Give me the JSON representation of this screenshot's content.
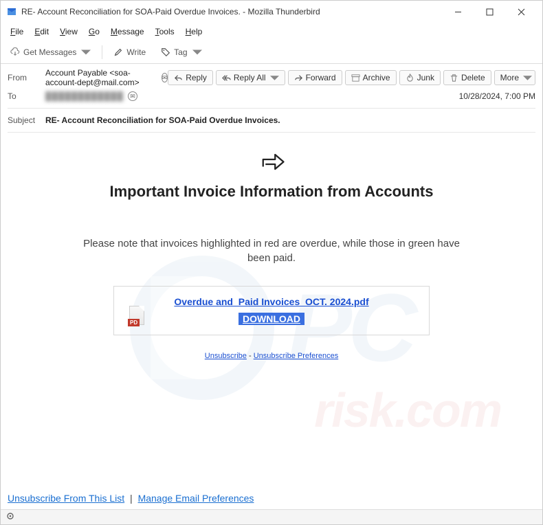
{
  "window": {
    "title": "RE- Account Reconciliation for SOA-Paid Overdue Invoices. - Mozilla Thunderbird"
  },
  "menu": {
    "file": "File",
    "edit": "Edit",
    "view": "View",
    "go": "Go",
    "message": "Message",
    "tools": "Tools",
    "help": "Help"
  },
  "toolbar": {
    "get_messages": "Get Messages",
    "write": "Write",
    "tag": "Tag"
  },
  "headers": {
    "from_label": "From",
    "from_value": "Account Payable <soa-account-dept@mail.com>",
    "to_label": "To",
    "to_value": "████████████",
    "subject_label": "Subject",
    "subject_value": "RE- Account Reconciliation for SOA-Paid Overdue Invoices.",
    "date": "10/28/2024, 7:00 PM"
  },
  "actions": {
    "reply": "Reply",
    "reply_all": "Reply All",
    "forward": "Forward",
    "archive": "Archive",
    "junk": "Junk",
    "delete": "Delete",
    "more": "More"
  },
  "email": {
    "heading": "Important Invoice Information from Accounts",
    "body": "Please note that invoices highlighted in red are overdue, while those in green have been paid.",
    "attachment_name": "Overdue and_Paid Invoices_OCT. 2024.pdf",
    "download": "DOWNLOAD",
    "pdf_badge": "PD",
    "unsubscribe": "Unsubscribe",
    "unsub_sep": " - ",
    "unsub_prefs": "Unsubscribe Preferences"
  },
  "footer": {
    "unsubscribe": "Unsubscribe From This List",
    "manage": "Manage Email Preferences",
    "sep": "|"
  },
  "status": {
    "icon_label": "(○)"
  }
}
